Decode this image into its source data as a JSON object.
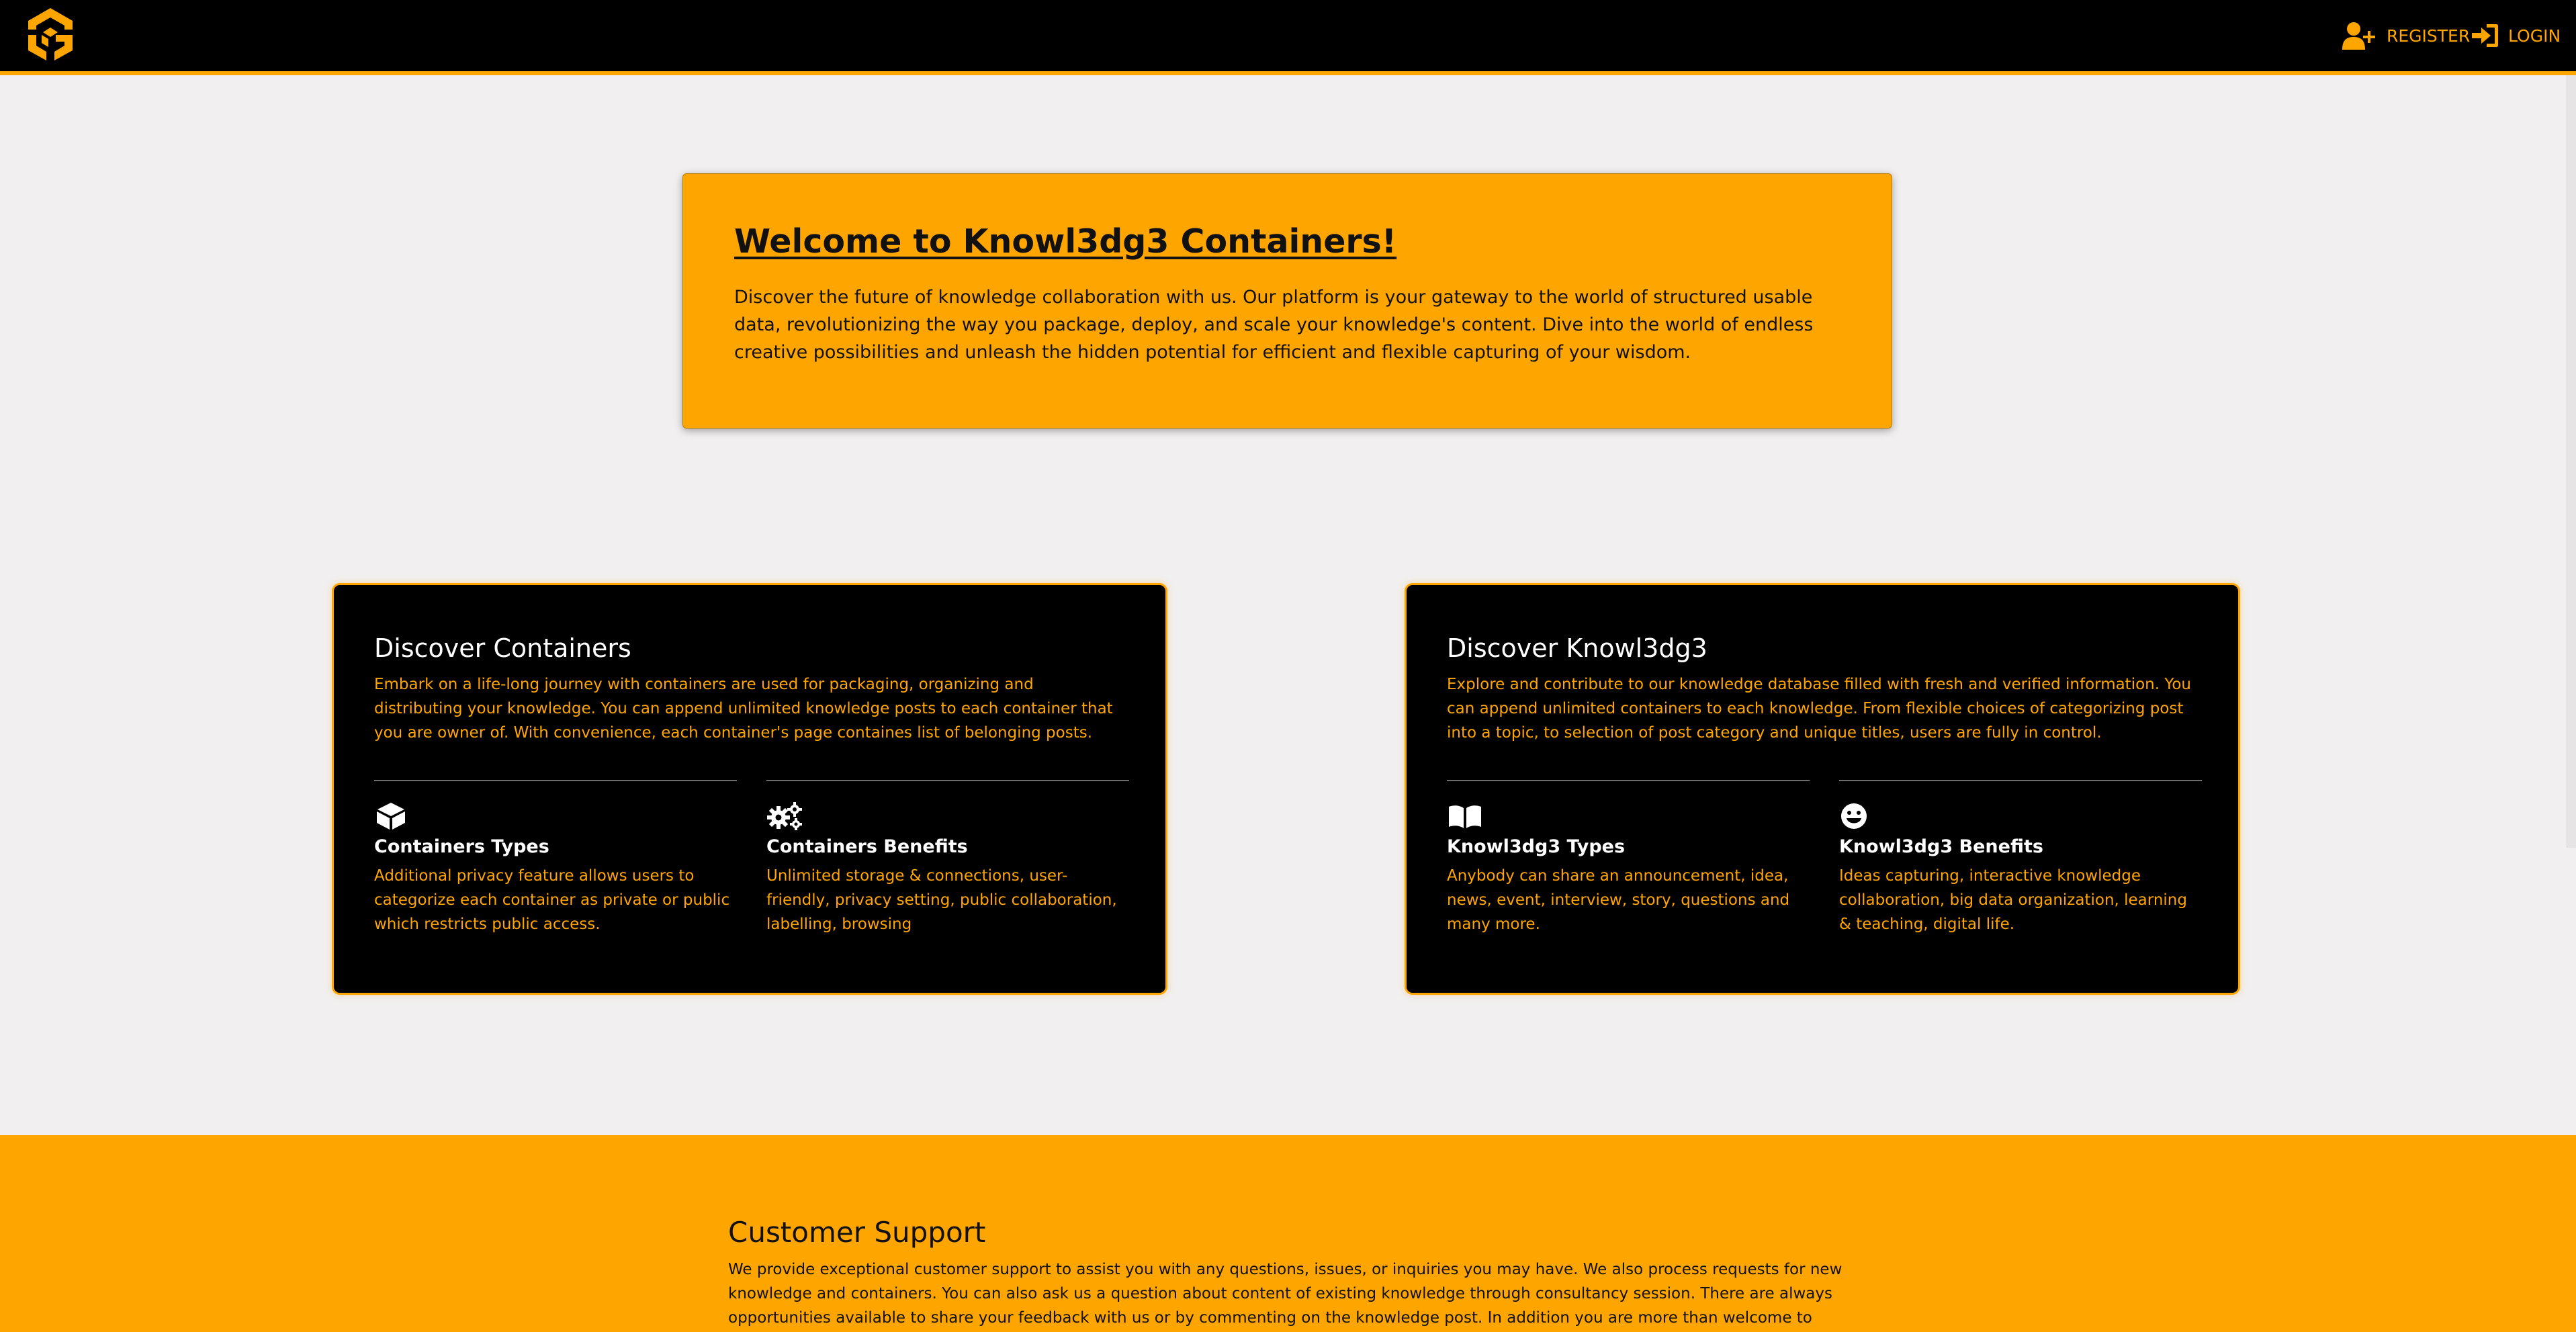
{
  "nav": {
    "logo_icon": "knowl3dg3-cube-logo",
    "register_label": "REGISTER",
    "register_icon": "user-plus-icon",
    "login_label": "LOGIN",
    "login_icon": "sign-in-icon"
  },
  "welcome": {
    "title": "Welcome to Knowl3dg3 Containers!",
    "text": "Discover the future of knowledge collaboration with us. Our platform is your gateway to the world of structured usable data, revolutionizing the way you package, deploy, and scale your knowledge's content. Dive into the world of endless creative possibilities and unleash the hidden potential for efficient and flexible capturing of your wisdom."
  },
  "cards": [
    {
      "title": "Discover Containers",
      "text": "Embark on a life-long journey with containers are used for packaging, organizing and distributing your knowledge. You can append unlimited knowledge posts to each container that you are owner of. With convenience, each container's page containes list of belonging posts.",
      "columns": [
        {
          "icon": "cube-icon",
          "title": "Containers Types",
          "text": "Additional privacy feature allows users to categorize each container as private or public which restricts public access."
        },
        {
          "icon": "gears-icon",
          "title": "Containers Benefits",
          "text": "Unlimited storage & connections, user-friendly, privacy setting, public collaboration, labelling, browsing"
        }
      ]
    },
    {
      "title": "Discover Knowl3dg3",
      "text": "Explore and contribute to our knowledge database filled with fresh and verified information. You can append unlimited containers to each knowledge. From flexible choices of categorizing post into a topic, to selection of post category and unique titles, users are fully in control.",
      "columns": [
        {
          "icon": "open-book-icon",
          "title": "Knowl3dg3 Types",
          "text": "Anybody can share an announcement, idea, news, event, interview, story, questions and many more."
        },
        {
          "icon": "smiley-icon",
          "title": "Knowl3dg3 Benefits",
          "text": "Ideas capturing, interactive knowledge collaboration, big data organization, learning & teaching, digital life."
        }
      ]
    }
  ],
  "support": {
    "title": "Customer Support",
    "text": "We provide exceptional customer support to assist you with any questions, issues, or inquiries you may have. We also process requests for new knowledge and containers. You can also ask us a question about content of existing knowledge through consultancy session. There are always opportunities available to share your feedback with us or by commenting on the knowledge post. In addition you are more than welcome to subimt"
  },
  "colors": {
    "accent": "#ffa500",
    "navbar": "#000000",
    "page_background": "#f1efef",
    "card_background": "#000000"
  }
}
